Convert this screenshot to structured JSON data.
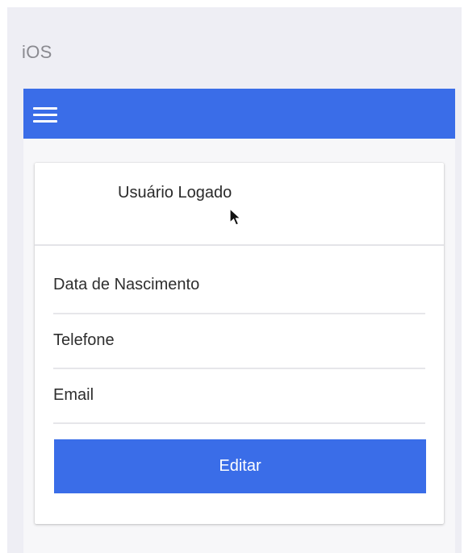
{
  "platform_label": "iOS",
  "toolbar": {
    "menu_icon": "hamburger-menu-icon",
    "color": "#3a6de8"
  },
  "card": {
    "title": "Usuário Logado",
    "fields": [
      "Data de Nascimento",
      "Telefone",
      "Email"
    ],
    "edit_label": "Editar"
  },
  "colors": {
    "accent": "#3a6de8",
    "background": "#eeeef4"
  }
}
